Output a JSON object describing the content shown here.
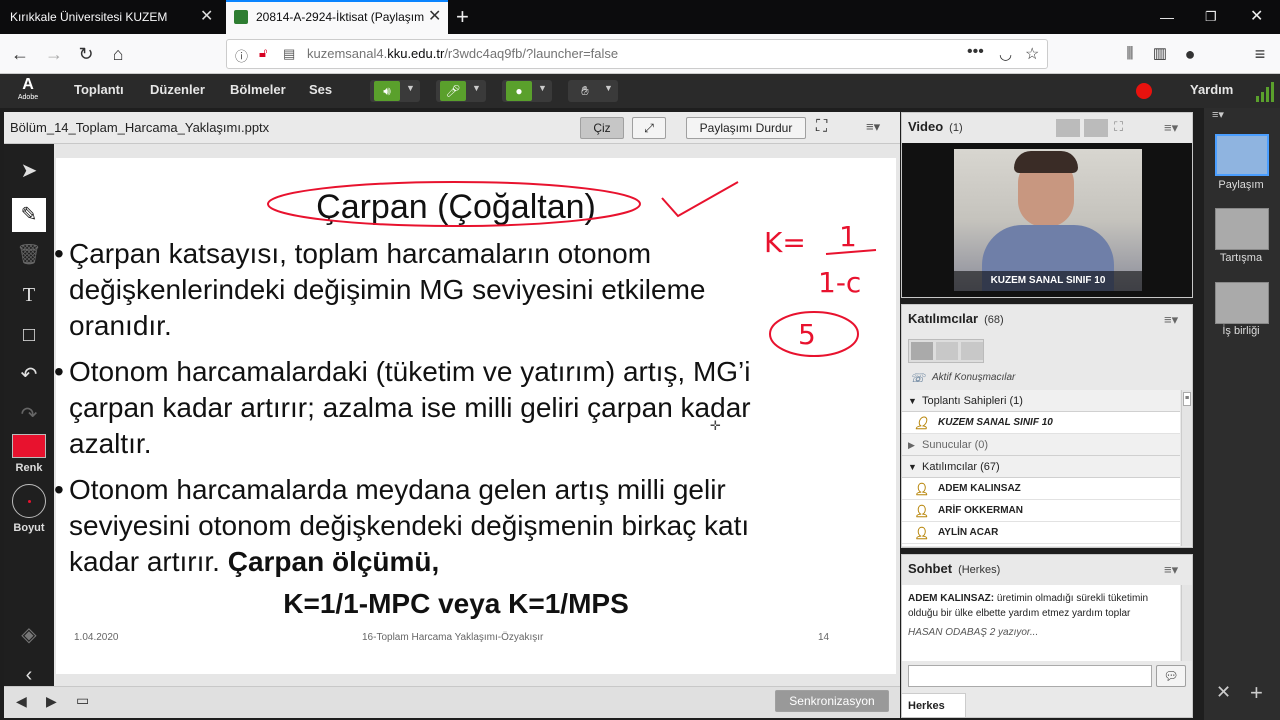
{
  "browser": {
    "tabs": [
      {
        "label": "Kırıkkale Üniversitesi KUZEM"
      },
      {
        "label": "20814-A-2924-İktisat (Paylaşım"
      }
    ],
    "url_host_prefix": "kuzemsanal4.",
    "url_host_domain": "kku.edu.tr",
    "url_path": "/r3wdc4aq9fb/?launcher=false"
  },
  "menu": {
    "adobe": "Adobe",
    "items": [
      "Toplantı",
      "Düzenler",
      "Bölmeler",
      "Ses"
    ],
    "help": "Yardım"
  },
  "rail": {
    "layouts": [
      "Paylaşım",
      "Tartışma",
      "İş birliği"
    ]
  },
  "share": {
    "filename": "Bölüm_14_Toplam_Harcama_Yaklaşımı.pptx",
    "draw_button": "Çiz",
    "stop_button": "Paylaşımı Durdur",
    "sync_button": "Senkronizasyon",
    "color_label": "Renk",
    "size_label": "Boyut",
    "color_value": "#e8122e"
  },
  "slide": {
    "title": "Çarpan (Çoğaltan)",
    "bullets": [
      [
        "Çarpan katsayısı, toplam harcamaların otonom",
        "değişkenlerindeki değişimin MG seviyesini etkileme",
        "oranıdır."
      ],
      [
        "Otonom harcamalardaki (tüketim ve yatırım) artış, MG’i",
        "çarpan kadar artırır; azalma ise milli geliri çarpan kadar",
        "azaltır."
      ],
      [
        "Otonom harcamalarda meydana gelen artış milli gelir",
        "seviyesini otonom değişkendeki değişmenin birkaç katı",
        "kadar artırır. "
      ]
    ],
    "bold_tail": "Çarpan ölçümü,",
    "formula": "K=1/1-MPC veya K=1/MPS",
    "footer_date": "1.04.2020",
    "footer_title": "16-Toplam Harcama Yaklaşımı-Özyakışır",
    "footer_page": "14",
    "ink": {
      "k_label": "K=",
      "numerator": "1",
      "denominator": "1-c",
      "answer": "5"
    }
  },
  "video": {
    "title": "Video",
    "count": "(1)",
    "caption": "KUZEM SANAL SINIF 10"
  },
  "attendees": {
    "title": "Katılımcılar",
    "count": "(68)",
    "active_speakers": "Aktif Konuşmacılar",
    "groups": [
      {
        "label": "Toplantı Sahipleri (1)",
        "members": [
          "KUZEM SANAL SINIF 10"
        ]
      },
      {
        "label": "Sunucular (0)",
        "members": []
      },
      {
        "label": "Katılımcılar (67)",
        "members": [
          "ADEM KALINSAZ",
          "ARİF OKKERMAN",
          "AYLİN ACAR"
        ]
      }
    ]
  },
  "chat": {
    "title": "Sohbet",
    "scope": "(Herkes)",
    "message_author": "ADEM KALINSAZ:",
    "message_text": " üretimin olmadığı sürekli tüketimin olduğu bir ülke elbette yardım etmez yardım toplar",
    "typing": "HASAN ODABAŞ 2 yazıyor...",
    "input_placeholder": "",
    "recipient": "Herkes"
  }
}
